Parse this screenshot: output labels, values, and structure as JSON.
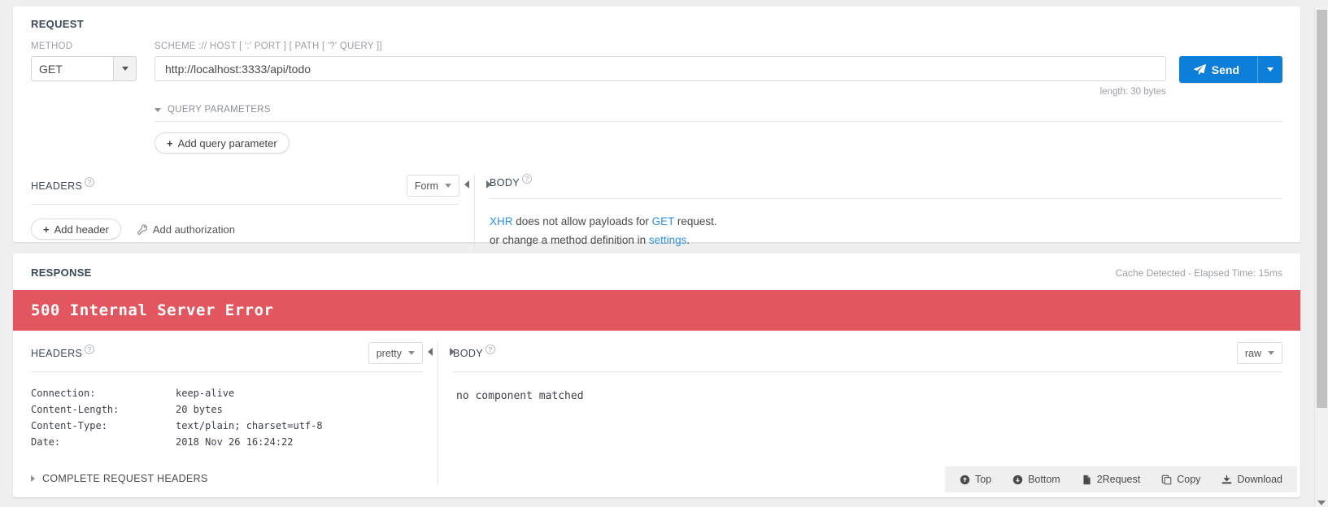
{
  "request": {
    "title": "REQUEST",
    "method_label": "METHOD",
    "method_value": "GET",
    "url_label": "SCHEME :// HOST [ ':' PORT ] [ PATH [ '?' QUERY ]]",
    "url_value": "http://localhost:3333/api/todo",
    "length_note": "length: 30 bytes",
    "send_label": "Send",
    "query_parameters": {
      "title": "QUERY PARAMETERS",
      "add_label": "Add query parameter",
      "add_plus": "+"
    },
    "headers": {
      "title": "HEADERS",
      "help": "?",
      "format_value": "Form",
      "add_header_label": "Add header",
      "add_header_plus": "+",
      "add_authorization_label": "Add authorization"
    },
    "body": {
      "title": "BODY",
      "help": "?",
      "line1_part1": "XHR",
      "line1_part2": " does not allow payloads for ",
      "line1_part3": "GET",
      "line1_part4": " request.",
      "line2_part1": "or change a method definition in ",
      "line2_part2": "settings",
      "line2_part3": "."
    }
  },
  "response": {
    "title": "RESPONSE",
    "meta": "Cache Detected - Elapsed Time: 15ms",
    "status_text": "500 Internal Server Error",
    "status_color": "#e2565f",
    "headers": {
      "title": "HEADERS",
      "help": "?",
      "format_value": "pretty",
      "rows": [
        {
          "key": "Connection:",
          "value": "keep-alive"
        },
        {
          "key": "Content-Length:",
          "value": "20 bytes"
        },
        {
          "key": "Content-Type:",
          "value": "text/plain; charset=utf-8"
        },
        {
          "key": "Date:",
          "value": "2018 Nov 26 16:24:22"
        }
      ],
      "complete_label": "COMPLETE REQUEST HEADERS"
    },
    "body": {
      "title": "BODY",
      "help": "?",
      "format_value": "raw",
      "content": "no component matched"
    }
  },
  "toolbar": {
    "top_label": "Top",
    "bottom_label": "Bottom",
    "request_label": "2Request",
    "copy_label": "Copy",
    "download_label": "Download"
  },
  "colors": {
    "accent": "#0d7fd9",
    "error": "#e2565f",
    "link": "#2f8fe0"
  }
}
